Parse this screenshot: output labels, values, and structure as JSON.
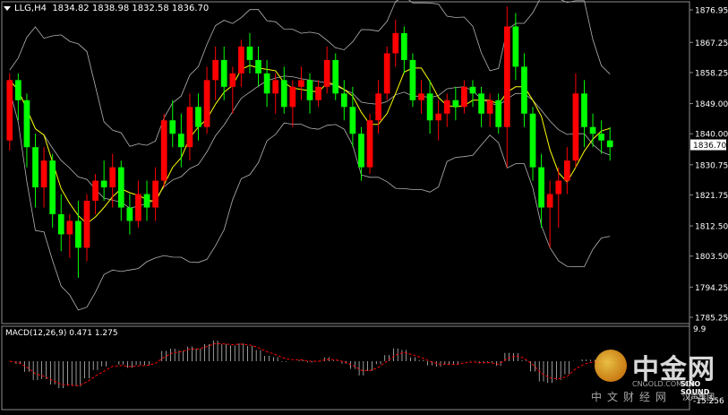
{
  "header": {
    "symbol_label": "LLG,H4",
    "ohlc": "1834.82 1838.98 1832.58 1836.70",
    "dropdown_icon": "triangle-down-icon"
  },
  "macd": {
    "label": "MACD(12,26,9) 0.471 1.275",
    "scale_top": "9.9",
    "scale_bottom": "-15.256"
  },
  "price_axis": {
    "ticks": [
      "1876.95",
      "1867.25",
      "1858.25",
      "1849.00",
      "1840.00",
      "1830.75",
      "1821.75",
      "1812.50",
      "1803.50",
      "1794.25",
      "1785.25"
    ],
    "current_price": "1836.70"
  },
  "watermark": {
    "brand_cn": "中金网",
    "brand_url": "CNGOLD.COM.CN",
    "brand_sub": "中文财经网",
    "partner": "SINO SOUND",
    "partner_cn": "汉声集团"
  },
  "colors": {
    "background": "#000000",
    "bull_candle": "#ff0000",
    "bear_candle": "#00ff00",
    "bands": "#b4b4b4",
    "ma": "#ffff00",
    "macd_hist": "#ffffff",
    "macd_signal": "#ff0000",
    "axis_text": "#ffffff",
    "current_price_bg": "#ffffff"
  },
  "chart_data": {
    "type": "candlestick",
    "timeframe": "H4",
    "ylim": [
      1785.25,
      1876.95
    ],
    "ohlc": [
      [
        1838,
        1858,
        1835,
        1856
      ],
      [
        1856,
        1858,
        1844,
        1850
      ],
      [
        1850,
        1852,
        1830,
        1836
      ],
      [
        1836,
        1840,
        1818,
        1824
      ],
      [
        1824,
        1836,
        1818,
        1832
      ],
      [
        1832,
        1834,
        1812,
        1816
      ],
      [
        1816,
        1822,
        1805,
        1810
      ],
      [
        1810,
        1816,
        1803,
        1814
      ],
      [
        1814,
        1820,
        1797,
        1806
      ],
      [
        1806,
        1822,
        1802,
        1820
      ],
      [
        1820,
        1828,
        1816,
        1826
      ],
      [
        1826,
        1832,
        1820,
        1824
      ],
      [
        1824,
        1834,
        1818,
        1830
      ],
      [
        1830,
        1832,
        1814,
        1818
      ],
      [
        1818,
        1822,
        1810,
        1814
      ],
      [
        1814,
        1826,
        1812,
        1822
      ],
      [
        1822,
        1826,
        1814,
        1818
      ],
      [
        1818,
        1830,
        1814,
        1826
      ],
      [
        1826,
        1846,
        1824,
        1844
      ],
      [
        1844,
        1850,
        1836,
        1840
      ],
      [
        1840,
        1846,
        1830,
        1836
      ],
      [
        1836,
        1852,
        1832,
        1848
      ],
      [
        1848,
        1852,
        1838,
        1842
      ],
      [
        1842,
        1860,
        1840,
        1856
      ],
      [
        1856,
        1866,
        1850,
        1862
      ],
      [
        1862,
        1866,
        1850,
        1854
      ],
      [
        1854,
        1860,
        1846,
        1858
      ],
      [
        1858,
        1868,
        1854,
        1866
      ],
      [
        1866,
        1870,
        1858,
        1862
      ],
      [
        1862,
        1866,
        1854,
        1858
      ],
      [
        1858,
        1862,
        1848,
        1852
      ],
      [
        1852,
        1858,
        1846,
        1856
      ],
      [
        1856,
        1860,
        1846,
        1848
      ],
      [
        1848,
        1856,
        1842,
        1854
      ],
      [
        1854,
        1860,
        1850,
        1856
      ],
      [
        1856,
        1858,
        1846,
        1850
      ],
      [
        1850,
        1856,
        1848,
        1854
      ],
      [
        1854,
        1866,
        1852,
        1862
      ],
      [
        1862,
        1864,
        1850,
        1852
      ],
      [
        1852,
        1856,
        1844,
        1848
      ],
      [
        1848,
        1854,
        1836,
        1840
      ],
      [
        1840,
        1842,
        1826,
        1830
      ],
      [
        1830,
        1846,
        1828,
        1844
      ],
      [
        1844,
        1856,
        1840,
        1852
      ],
      [
        1852,
        1866,
        1850,
        1864
      ],
      [
        1864,
        1874,
        1860,
        1870
      ],
      [
        1870,
        1872,
        1858,
        1862
      ],
      [
        1862,
        1864,
        1848,
        1850
      ],
      [
        1850,
        1856,
        1846,
        1852
      ],
      [
        1852,
        1856,
        1840,
        1844
      ],
      [
        1844,
        1850,
        1838,
        1846
      ],
      [
        1846,
        1852,
        1842,
        1850
      ],
      [
        1850,
        1854,
        1844,
        1848
      ],
      [
        1848,
        1856,
        1846,
        1854
      ],
      [
        1854,
        1856,
        1848,
        1852
      ],
      [
        1852,
        1854,
        1842,
        1846
      ],
      [
        1846,
        1852,
        1842,
        1850
      ],
      [
        1850,
        1852,
        1840,
        1842
      ],
      [
        1842,
        1878,
        1830,
        1872
      ],
      [
        1872,
        1876,
        1856,
        1860
      ],
      [
        1860,
        1864,
        1842,
        1846
      ],
      [
        1846,
        1848,
        1826,
        1830
      ],
      [
        1830,
        1834,
        1812,
        1818
      ],
      [
        1818,
        1826,
        1806,
        1822
      ],
      [
        1822,
        1830,
        1812,
        1826
      ],
      [
        1826,
        1836,
        1822,
        1832
      ],
      [
        1832,
        1858,
        1830,
        1852
      ],
      [
        1852,
        1856,
        1836,
        1842
      ],
      [
        1842,
        1846,
        1836,
        1840
      ],
      [
        1840,
        1844,
        1834,
        1838
      ],
      [
        1838,
        1842,
        1832,
        1836
      ]
    ]
  }
}
